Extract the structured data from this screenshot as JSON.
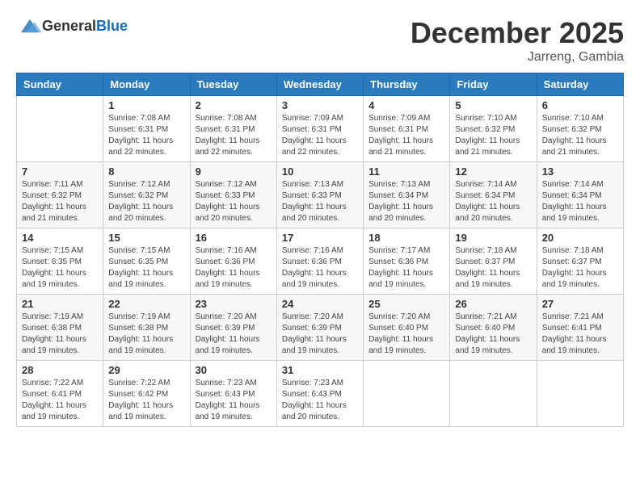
{
  "header": {
    "logo_general": "General",
    "logo_blue": "Blue",
    "month": "December 2025",
    "location": "Jarreng, Gambia"
  },
  "days_of_week": [
    "Sunday",
    "Monday",
    "Tuesday",
    "Wednesday",
    "Thursday",
    "Friday",
    "Saturday"
  ],
  "weeks": [
    [
      {
        "day": "",
        "sunrise": "",
        "sunset": "",
        "daylight": ""
      },
      {
        "day": "1",
        "sunrise": "Sunrise: 7:08 AM",
        "sunset": "Sunset: 6:31 PM",
        "daylight": "Daylight: 11 hours and 22 minutes."
      },
      {
        "day": "2",
        "sunrise": "Sunrise: 7:08 AM",
        "sunset": "Sunset: 6:31 PM",
        "daylight": "Daylight: 11 hours and 22 minutes."
      },
      {
        "day": "3",
        "sunrise": "Sunrise: 7:09 AM",
        "sunset": "Sunset: 6:31 PM",
        "daylight": "Daylight: 11 hours and 22 minutes."
      },
      {
        "day": "4",
        "sunrise": "Sunrise: 7:09 AM",
        "sunset": "Sunset: 6:31 PM",
        "daylight": "Daylight: 11 hours and 21 minutes."
      },
      {
        "day": "5",
        "sunrise": "Sunrise: 7:10 AM",
        "sunset": "Sunset: 6:32 PM",
        "daylight": "Daylight: 11 hours and 21 minutes."
      },
      {
        "day": "6",
        "sunrise": "Sunrise: 7:10 AM",
        "sunset": "Sunset: 6:32 PM",
        "daylight": "Daylight: 11 hours and 21 minutes."
      }
    ],
    [
      {
        "day": "7",
        "sunrise": "Sunrise: 7:11 AM",
        "sunset": "Sunset: 6:32 PM",
        "daylight": "Daylight: 11 hours and 21 minutes."
      },
      {
        "day": "8",
        "sunrise": "Sunrise: 7:12 AM",
        "sunset": "Sunset: 6:32 PM",
        "daylight": "Daylight: 11 hours and 20 minutes."
      },
      {
        "day": "9",
        "sunrise": "Sunrise: 7:12 AM",
        "sunset": "Sunset: 6:33 PM",
        "daylight": "Daylight: 11 hours and 20 minutes."
      },
      {
        "day": "10",
        "sunrise": "Sunrise: 7:13 AM",
        "sunset": "Sunset: 6:33 PM",
        "daylight": "Daylight: 11 hours and 20 minutes."
      },
      {
        "day": "11",
        "sunrise": "Sunrise: 7:13 AM",
        "sunset": "Sunset: 6:34 PM",
        "daylight": "Daylight: 11 hours and 20 minutes."
      },
      {
        "day": "12",
        "sunrise": "Sunrise: 7:14 AM",
        "sunset": "Sunset: 6:34 PM",
        "daylight": "Daylight: 11 hours and 20 minutes."
      },
      {
        "day": "13",
        "sunrise": "Sunrise: 7:14 AM",
        "sunset": "Sunset: 6:34 PM",
        "daylight": "Daylight: 11 hours and 19 minutes."
      }
    ],
    [
      {
        "day": "14",
        "sunrise": "Sunrise: 7:15 AM",
        "sunset": "Sunset: 6:35 PM",
        "daylight": "Daylight: 11 hours and 19 minutes."
      },
      {
        "day": "15",
        "sunrise": "Sunrise: 7:15 AM",
        "sunset": "Sunset: 6:35 PM",
        "daylight": "Daylight: 11 hours and 19 minutes."
      },
      {
        "day": "16",
        "sunrise": "Sunrise: 7:16 AM",
        "sunset": "Sunset: 6:36 PM",
        "daylight": "Daylight: 11 hours and 19 minutes."
      },
      {
        "day": "17",
        "sunrise": "Sunrise: 7:16 AM",
        "sunset": "Sunset: 6:36 PM",
        "daylight": "Daylight: 11 hours and 19 minutes."
      },
      {
        "day": "18",
        "sunrise": "Sunrise: 7:17 AM",
        "sunset": "Sunset: 6:36 PM",
        "daylight": "Daylight: 11 hours and 19 minutes."
      },
      {
        "day": "19",
        "sunrise": "Sunrise: 7:18 AM",
        "sunset": "Sunset: 6:37 PM",
        "daylight": "Daylight: 11 hours and 19 minutes."
      },
      {
        "day": "20",
        "sunrise": "Sunrise: 7:18 AM",
        "sunset": "Sunset: 6:37 PM",
        "daylight": "Daylight: 11 hours and 19 minutes."
      }
    ],
    [
      {
        "day": "21",
        "sunrise": "Sunrise: 7:19 AM",
        "sunset": "Sunset: 6:38 PM",
        "daylight": "Daylight: 11 hours and 19 minutes."
      },
      {
        "day": "22",
        "sunrise": "Sunrise: 7:19 AM",
        "sunset": "Sunset: 6:38 PM",
        "daylight": "Daylight: 11 hours and 19 minutes."
      },
      {
        "day": "23",
        "sunrise": "Sunrise: 7:20 AM",
        "sunset": "Sunset: 6:39 PM",
        "daylight": "Daylight: 11 hours and 19 minutes."
      },
      {
        "day": "24",
        "sunrise": "Sunrise: 7:20 AM",
        "sunset": "Sunset: 6:39 PM",
        "daylight": "Daylight: 11 hours and 19 minutes."
      },
      {
        "day": "25",
        "sunrise": "Sunrise: 7:20 AM",
        "sunset": "Sunset: 6:40 PM",
        "daylight": "Daylight: 11 hours and 19 minutes."
      },
      {
        "day": "26",
        "sunrise": "Sunrise: 7:21 AM",
        "sunset": "Sunset: 6:40 PM",
        "daylight": "Daylight: 11 hours and 19 minutes."
      },
      {
        "day": "27",
        "sunrise": "Sunrise: 7:21 AM",
        "sunset": "Sunset: 6:41 PM",
        "daylight": "Daylight: 11 hours and 19 minutes."
      }
    ],
    [
      {
        "day": "28",
        "sunrise": "Sunrise: 7:22 AM",
        "sunset": "Sunset: 6:41 PM",
        "daylight": "Daylight: 11 hours and 19 minutes."
      },
      {
        "day": "29",
        "sunrise": "Sunrise: 7:22 AM",
        "sunset": "Sunset: 6:42 PM",
        "daylight": "Daylight: 11 hours and 19 minutes."
      },
      {
        "day": "30",
        "sunrise": "Sunrise: 7:23 AM",
        "sunset": "Sunset: 6:43 PM",
        "daylight": "Daylight: 11 hours and 19 minutes."
      },
      {
        "day": "31",
        "sunrise": "Sunrise: 7:23 AM",
        "sunset": "Sunset: 6:43 PM",
        "daylight": "Daylight: 11 hours and 20 minutes."
      },
      {
        "day": "",
        "sunrise": "",
        "sunset": "",
        "daylight": ""
      },
      {
        "day": "",
        "sunrise": "",
        "sunset": "",
        "daylight": ""
      },
      {
        "day": "",
        "sunrise": "",
        "sunset": "",
        "daylight": ""
      }
    ]
  ]
}
